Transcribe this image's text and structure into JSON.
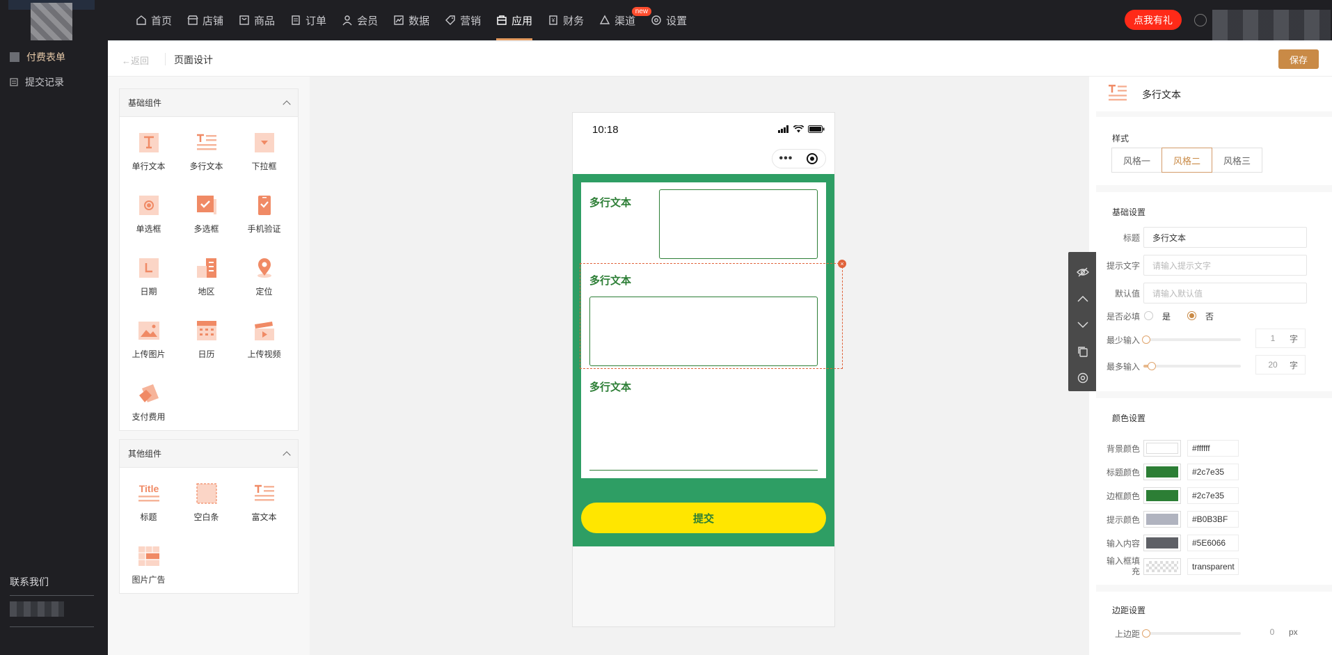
{
  "topbar": {
    "nav": [
      {
        "label": "首页",
        "icon": "home-icon"
      },
      {
        "label": "店铺",
        "icon": "store-icon"
      },
      {
        "label": "商品",
        "icon": "goods-icon"
      },
      {
        "label": "订单",
        "icon": "order-icon"
      },
      {
        "label": "会员",
        "icon": "member-icon"
      },
      {
        "label": "数据",
        "icon": "chart-icon"
      },
      {
        "label": "营销",
        "icon": "tag-icon"
      },
      {
        "label": "应用",
        "icon": "app-icon",
        "active": true
      },
      {
        "label": "财务",
        "icon": "finance-icon"
      },
      {
        "label": "渠道",
        "icon": "channel-icon",
        "badge": "new"
      },
      {
        "label": "设置",
        "icon": "settings-icon"
      }
    ],
    "gift_label": "点我有礼"
  },
  "sidebar": {
    "items": [
      {
        "label": "付费表单",
        "active": true
      },
      {
        "label": "提交记录"
      }
    ],
    "contact_label": "联系我们"
  },
  "subheader": {
    "back_label": "返回",
    "title": "页面设计",
    "save_label": "保存"
  },
  "components": {
    "basic": {
      "title": "基础组件",
      "items": [
        {
          "label": "单行文本",
          "icon": "single-text-icon"
        },
        {
          "label": "多行文本",
          "icon": "multi-text-icon"
        },
        {
          "label": "下拉框",
          "icon": "dropdown-icon"
        },
        {
          "label": "单选框",
          "icon": "radio-icon"
        },
        {
          "label": "多选框",
          "icon": "checkbox-icon"
        },
        {
          "label": "手机验证",
          "icon": "phone-verify-icon"
        },
        {
          "label": "日期",
          "icon": "date-icon"
        },
        {
          "label": "地区",
          "icon": "region-icon"
        },
        {
          "label": "定位",
          "icon": "location-icon"
        },
        {
          "label": "上传图片",
          "icon": "upload-image-icon"
        },
        {
          "label": "日历",
          "icon": "calendar-icon"
        },
        {
          "label": "上传视频",
          "icon": "upload-video-icon"
        },
        {
          "label": "支付费用",
          "icon": "payment-icon"
        }
      ]
    },
    "other": {
      "title": "其他组件",
      "items": [
        {
          "label": "标题",
          "icon": "title-icon",
          "icon_text": "Title"
        },
        {
          "label": "空白条",
          "icon": "blank-bar-icon"
        },
        {
          "label": "富文本",
          "icon": "rich-text-icon"
        },
        {
          "label": "图片广告",
          "icon": "image-ad-icon"
        }
      ]
    }
  },
  "phone": {
    "time": "10:18",
    "fields": [
      {
        "title": "多行文本"
      },
      {
        "title": "多行文本"
      },
      {
        "title": "多行文本"
      }
    ],
    "submit_label": "提交",
    "form_bg": "#2e9e64",
    "button_bg": "#ffe600"
  },
  "props": {
    "header_title": "多行文本",
    "style": {
      "label": "样式",
      "options": [
        "风格一",
        "风格二",
        "风格三"
      ],
      "selected_index": 1
    },
    "basic": {
      "label": "基础设置",
      "title_key": "标题",
      "title_value": "多行文本",
      "hint_key": "提示文字",
      "hint_placeholder": "请输入提示文字",
      "default_key": "默认值",
      "default_placeholder": "请输入默认值",
      "required_key": "是否必填",
      "required_yes": "是",
      "required_no": "否",
      "required_selected": "否",
      "min_key": "最少输入",
      "min_value": "1",
      "min_unit": "字",
      "max_key": "最多输入",
      "max_value": "20",
      "max_unit": "字"
    },
    "colors": {
      "label": "颜色设置",
      "rows": [
        {
          "key": "背景颜色",
          "value": "#ffffff",
          "swatch": "#ffffff"
        },
        {
          "key": "标题颜色",
          "value": "#2c7e35",
          "swatch": "#2c7e35"
        },
        {
          "key": "边框颜色",
          "value": "#2c7e35",
          "swatch": "#2c7e35"
        },
        {
          "key": "提示颜色",
          "value": "#B0B3BF",
          "swatch": "#B0B3BF"
        },
        {
          "key": "输入内容",
          "value": "#5E6066",
          "swatch": "#5E6066"
        },
        {
          "key": "输入框填充",
          "value": "transparent",
          "swatch": "transparent"
        }
      ]
    },
    "margins": {
      "label": "边距设置",
      "top_key": "上边距",
      "top_value": "0",
      "top_unit": "px"
    }
  },
  "accent": "#c98a46"
}
